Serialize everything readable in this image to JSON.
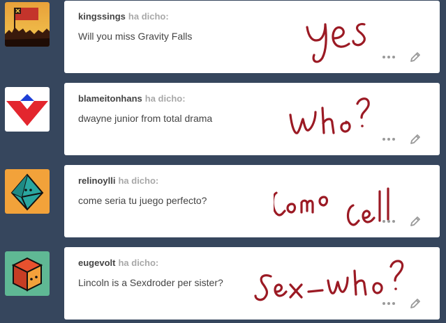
{
  "posts": [
    {
      "asker": "kingssings",
      "said": "ha dicho:",
      "question": "Will you miss Gravity Falls",
      "answer_handwritten": "Yes",
      "avatar_icon": "flag-sunset-avatar"
    },
    {
      "asker": "blameitonhans",
      "said": "ha dicho:",
      "question": "dwayne junior from total drama",
      "answer_handwritten": "Who?",
      "avatar_icon": "red-chevron-avatar"
    },
    {
      "asker": "relinoylli",
      "said": "ha dicho:",
      "question": "come seria tu juego perfecto?",
      "answer_handwritten": "Como Cell",
      "avatar_icon": "octahedron-avatar"
    },
    {
      "asker": "eugevolt",
      "said": "ha dicho:",
      "question": "Lincoln is a Sexdroder per sister?",
      "answer_handwritten": "Sex-who?",
      "avatar_icon": "cube-avatar"
    }
  ],
  "colors": {
    "background": "#36465d",
    "card": "#ffffff",
    "handwriting": "#9b1a24"
  },
  "icons": {
    "more": "more-dots-icon",
    "edit": "pencil-icon"
  }
}
